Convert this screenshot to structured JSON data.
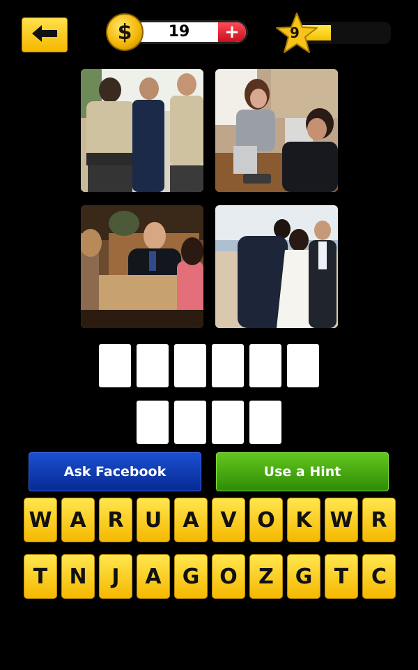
{
  "header": {
    "back_icon": "arrow-left-icon",
    "coin_symbol": "$",
    "coin_count": "19",
    "add_coins_symbol": "+",
    "level_number": "9",
    "level_progress_fraction": 0.5
  },
  "photos": [
    {
      "name": "photo-1",
      "description_icon": "image"
    },
    {
      "name": "photo-2",
      "description_icon": "image"
    },
    {
      "name": "photo-3",
      "description_icon": "image"
    },
    {
      "name": "photo-4",
      "description_icon": "image"
    }
  ],
  "answer": {
    "row1_slots": 6,
    "row2_slots": 4
  },
  "buttons": {
    "ask_facebook": "Ask Facebook",
    "use_hint": "Use a Hint"
  },
  "keyboard": {
    "row1": [
      "W",
      "A",
      "R",
      "U",
      "A",
      "V",
      "O",
      "K",
      "W",
      "R"
    ],
    "row2": [
      "T",
      "N",
      "J",
      "A",
      "G",
      "O",
      "Z",
      "G",
      "T",
      "C"
    ]
  },
  "colors": {
    "background": "#000000",
    "key_yellow": "#ffd21f",
    "facebook_blue": "#0b36b0",
    "hint_green": "#3fa010",
    "plus_red": "#e21f2d"
  }
}
